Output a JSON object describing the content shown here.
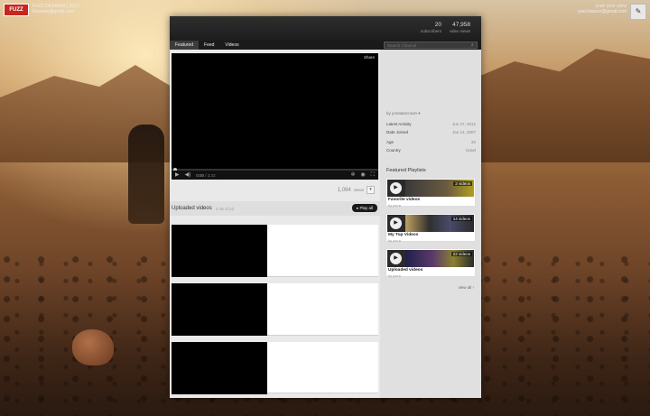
{
  "corner_left": {
    "logo": "FUZZ",
    "line1": "FUZZ DESIGNS | 2012",
    "line2": "fuzzweb@gmail.com"
  },
  "corner_right": {
    "line1": "עיצוב ערוץ יוטיוב",
    "line2": "paul.basecr@gmail.com"
  },
  "header": {
    "subscribers_num": "20",
    "subscribers_label": "subscribers",
    "views_num": "47,958",
    "views_label": "video views"
  },
  "nav": {
    "tabs": [
      {
        "label": "Featured"
      },
      {
        "label": "Feed"
      },
      {
        "label": "Videos"
      }
    ],
    "search_placeholder": "Search Channel"
  },
  "player": {
    "share_label": "Share",
    "time_current": "0:00",
    "time_duration": "/ 3:33",
    "views_num": "1,094",
    "views_label": "views"
  },
  "uploaded": {
    "title": "Uploaded videos",
    "count": "1-15 of 22",
    "play_all": "▸ Play all"
  },
  "about": {
    "by_label": "by yonatancrown ▾",
    "rows": [
      {
        "k": "Latest Activity",
        "v": "Jun 27, 2012"
      },
      {
        "k": "Date Joined",
        "v": "Jan 14, 2007"
      },
      {
        "k": "Age",
        "v": "20"
      },
      {
        "k": "Country",
        "v": "Israel"
      }
    ]
  },
  "featured_playlists": {
    "title": "Featured Playlists",
    "items": [
      {
        "name": "Favorite videos",
        "by": "by you ▸",
        "count": "2 videos"
      },
      {
        "name": "My Top Videos",
        "by": "by you ▸",
        "count": "14 videos"
      },
      {
        "name": "Uploaded videos",
        "by": "by you ▸",
        "count": "22 videos"
      }
    ],
    "view_all": "view all ›"
  },
  "colors": {
    "panel_bg": "#e9e9e9",
    "header_bg": "#1d1d1d",
    "accent_logo": "#c8261e"
  }
}
